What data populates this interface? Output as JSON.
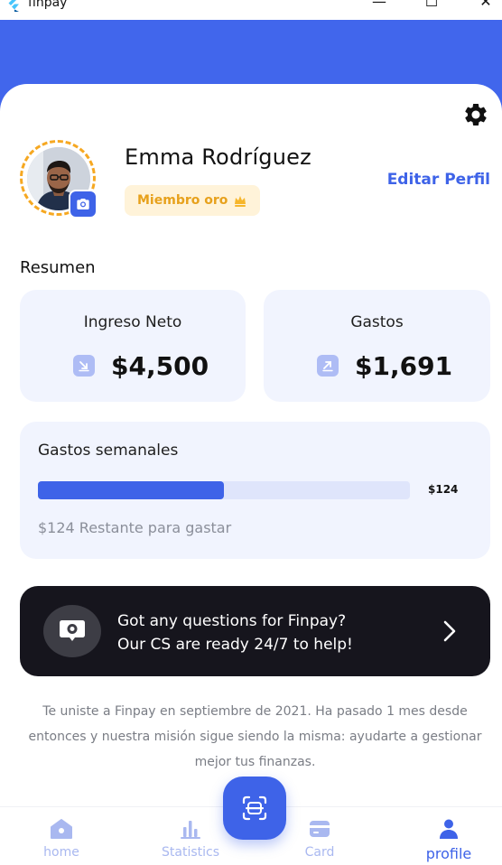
{
  "window": {
    "title": "finpay",
    "minimize_symbol": "—",
    "maximize_symbol": "☐",
    "close_symbol": "✕"
  },
  "profile": {
    "name": "Emma Rodríguez",
    "member_badge": "Miembro oro",
    "badge_icon": "crown-icon",
    "edit_label": "Editar Perfil"
  },
  "summary": {
    "title": "Resumen",
    "income_label": "Ingreso Neto",
    "income_value": "$4,500",
    "expenses_label": "Gastos",
    "expenses_value": "$1,691"
  },
  "weekly": {
    "title": "Gastos semanales",
    "amount": "$124",
    "remaining": "$124 Restante para gastar",
    "progress_fraction": 0.5
  },
  "help": {
    "line1": "Got any questions for Finpay?",
    "line2": "Our CS are ready 24/7 to help!"
  },
  "join_note": "Te uniste a Finpay en septiembre de 2021. Ha pasado 1 mes desde entonces y nuestra misión sigue siendo la misma: ayudarte a gestionar mejor tus finanzas.",
  "nav": {
    "home": "home",
    "statistics": "Statistics",
    "card": "Card",
    "profile": "profile",
    "active": "profile"
  },
  "colors": {
    "primary": "#3E63E8",
    "header": "#4166EC",
    "gold": "#F6A821",
    "dark_banner": "#16151D",
    "card_bg": "#F1F4FE"
  }
}
